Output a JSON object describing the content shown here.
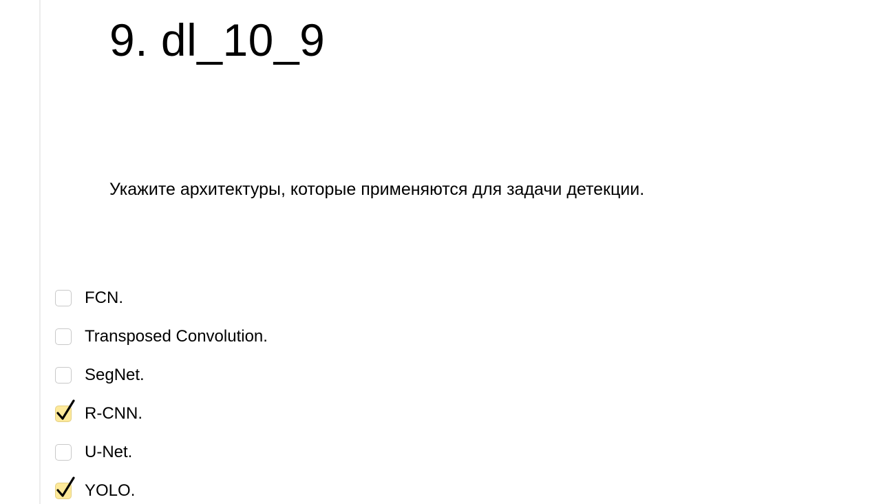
{
  "question": {
    "title": "9. dl_10_9",
    "text": "Укажите архитектуры, которые применяются для задачи детекции."
  },
  "options": [
    {
      "label": "FCN.",
      "checked": false
    },
    {
      "label": "Transposed Convolution.",
      "checked": false
    },
    {
      "label": "SegNet.",
      "checked": false
    },
    {
      "label": "R-CNN.",
      "checked": true
    },
    {
      "label": "U-Net.",
      "checked": false
    },
    {
      "label": "YOLO.",
      "checked": true
    }
  ],
  "colors": {
    "checked_fill": "#fde99a",
    "checkbox_border": "#c8c8c8",
    "check_mark": "#000000"
  }
}
